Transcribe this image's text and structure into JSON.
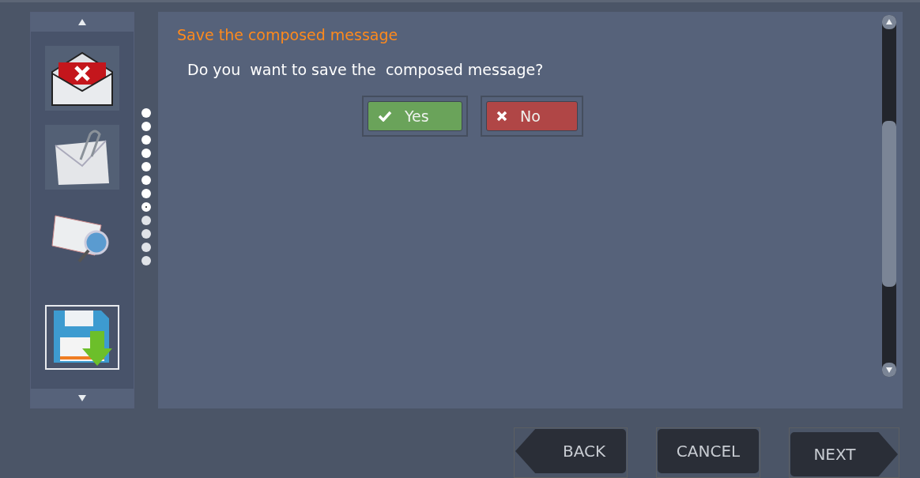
{
  "sidebar": {
    "items": [
      {
        "kind": "discard",
        "selected": false
      },
      {
        "kind": "attach",
        "selected": false
      },
      {
        "kind": "preview",
        "selected": false
      },
      {
        "kind": "save",
        "selected": true
      }
    ]
  },
  "steps": [
    {
      "done": true,
      "selected": false
    },
    {
      "done": true,
      "selected": false
    },
    {
      "done": true,
      "selected": false
    },
    {
      "done": true,
      "selected": false
    },
    {
      "done": true,
      "selected": false
    },
    {
      "done": true,
      "selected": false
    },
    {
      "done": true,
      "selected": false
    },
    {
      "done": false,
      "selected": true
    },
    {
      "done": false,
      "selected": false
    },
    {
      "done": false,
      "selected": false
    },
    {
      "done": false,
      "selected": false
    },
    {
      "done": false,
      "selected": false
    }
  ],
  "dialog": {
    "title": "Save the composed message",
    "question": "Do you  want to save the  composed message?",
    "buttons": [
      {
        "kind": "yes",
        "label": "Yes"
      },
      {
        "kind": "no",
        "label": "No"
      }
    ]
  },
  "nav": [
    {
      "kind": "back",
      "label": "BACK"
    },
    {
      "kind": "cancel",
      "label": "CANCEL"
    },
    {
      "kind": "next",
      "label": "NEXT"
    }
  ]
}
